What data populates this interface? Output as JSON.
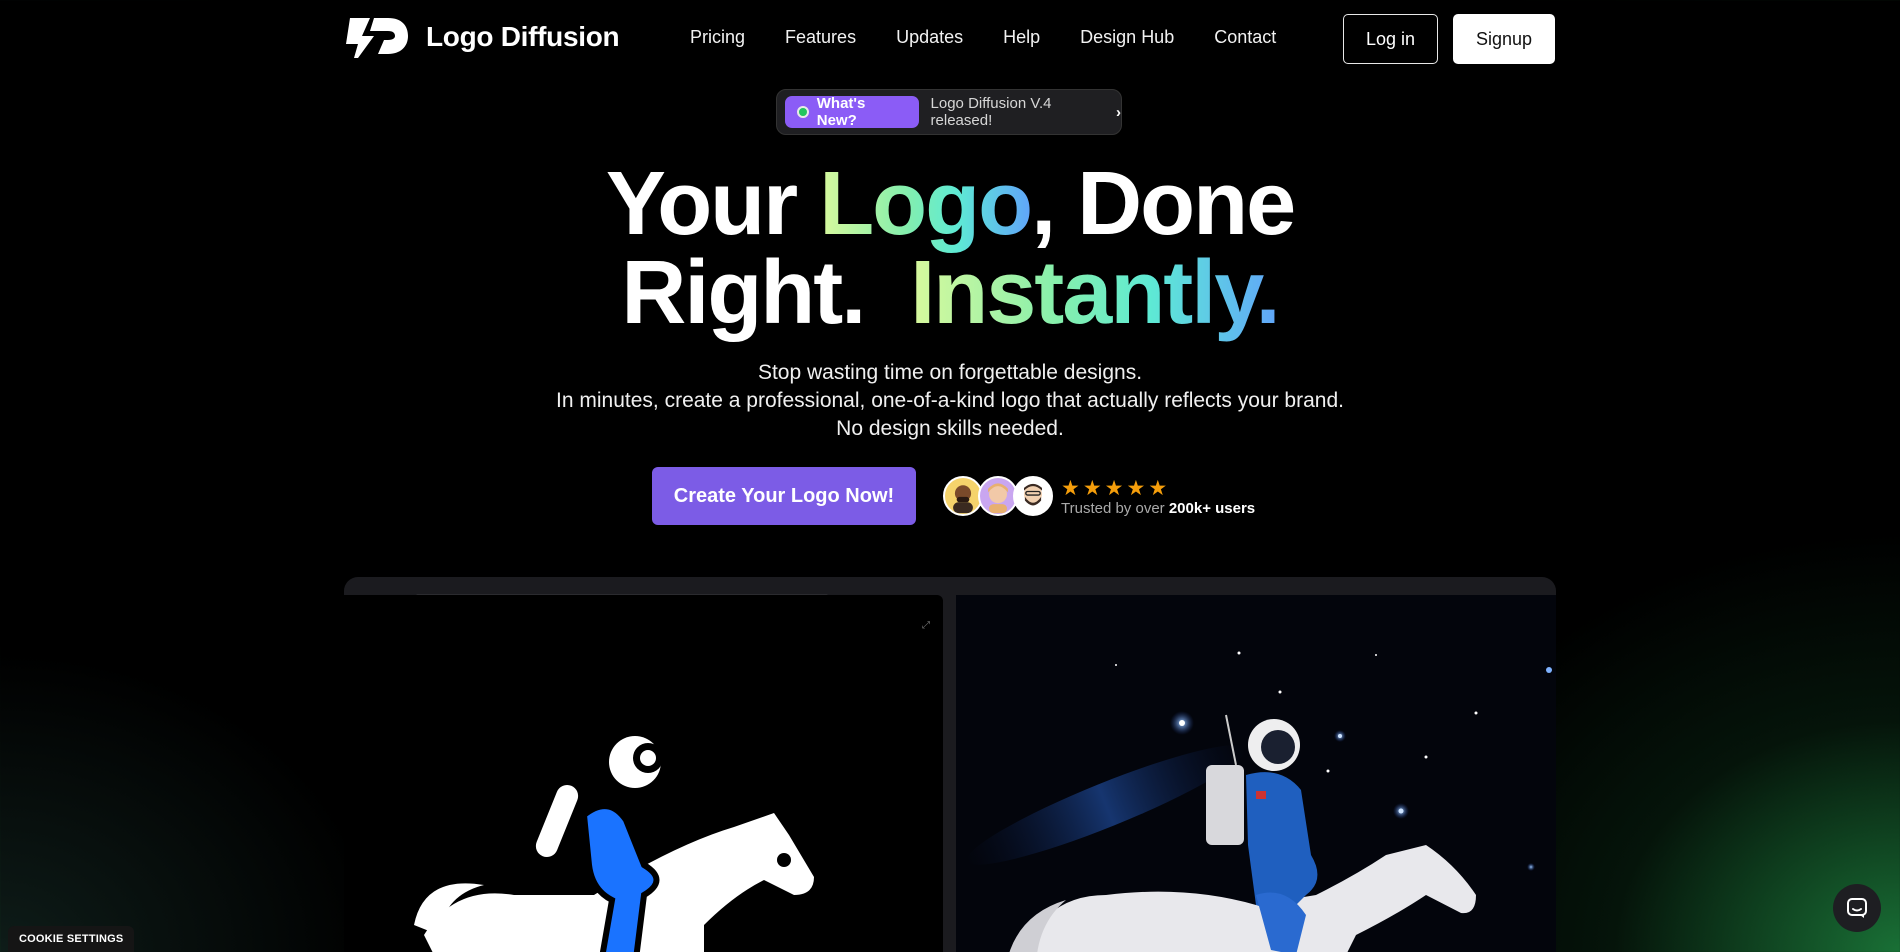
{
  "brand": {
    "name": "Logo Diffusion"
  },
  "nav": {
    "links": [
      "Pricing",
      "Features",
      "Updates",
      "Help",
      "Design Hub",
      "Contact"
    ],
    "login_label": "Log in",
    "signup_label": "Signup"
  },
  "news": {
    "badge": "What's New?",
    "text": "Logo Diffusion V.4 released!",
    "chevron": "›"
  },
  "hero": {
    "line1_a": "Your ",
    "line1_highlight": "Logo",
    "line1_b": ", Done",
    "line2_a": "Right.  ",
    "line2_highlight": "Instantly.",
    "sub1": "Stop wasting time on forgettable designs.",
    "sub2": "In minutes, create a professional, one-of-a-kind logo that actually reflects your brand.",
    "sub3": "No design skills needed.",
    "cta_label": "Create Your Logo Now!",
    "rating_stars": 5,
    "trusted_prefix": "Trusted by over ",
    "trusted_count": "200k+ users"
  },
  "footer": {
    "cookie_label": "COOKIE SETTINGS"
  },
  "colors": {
    "accent": "#7c5ce6",
    "badge": "#8b5cf6",
    "star": "#f59e0b",
    "logo_blue": "#1a73ff"
  }
}
